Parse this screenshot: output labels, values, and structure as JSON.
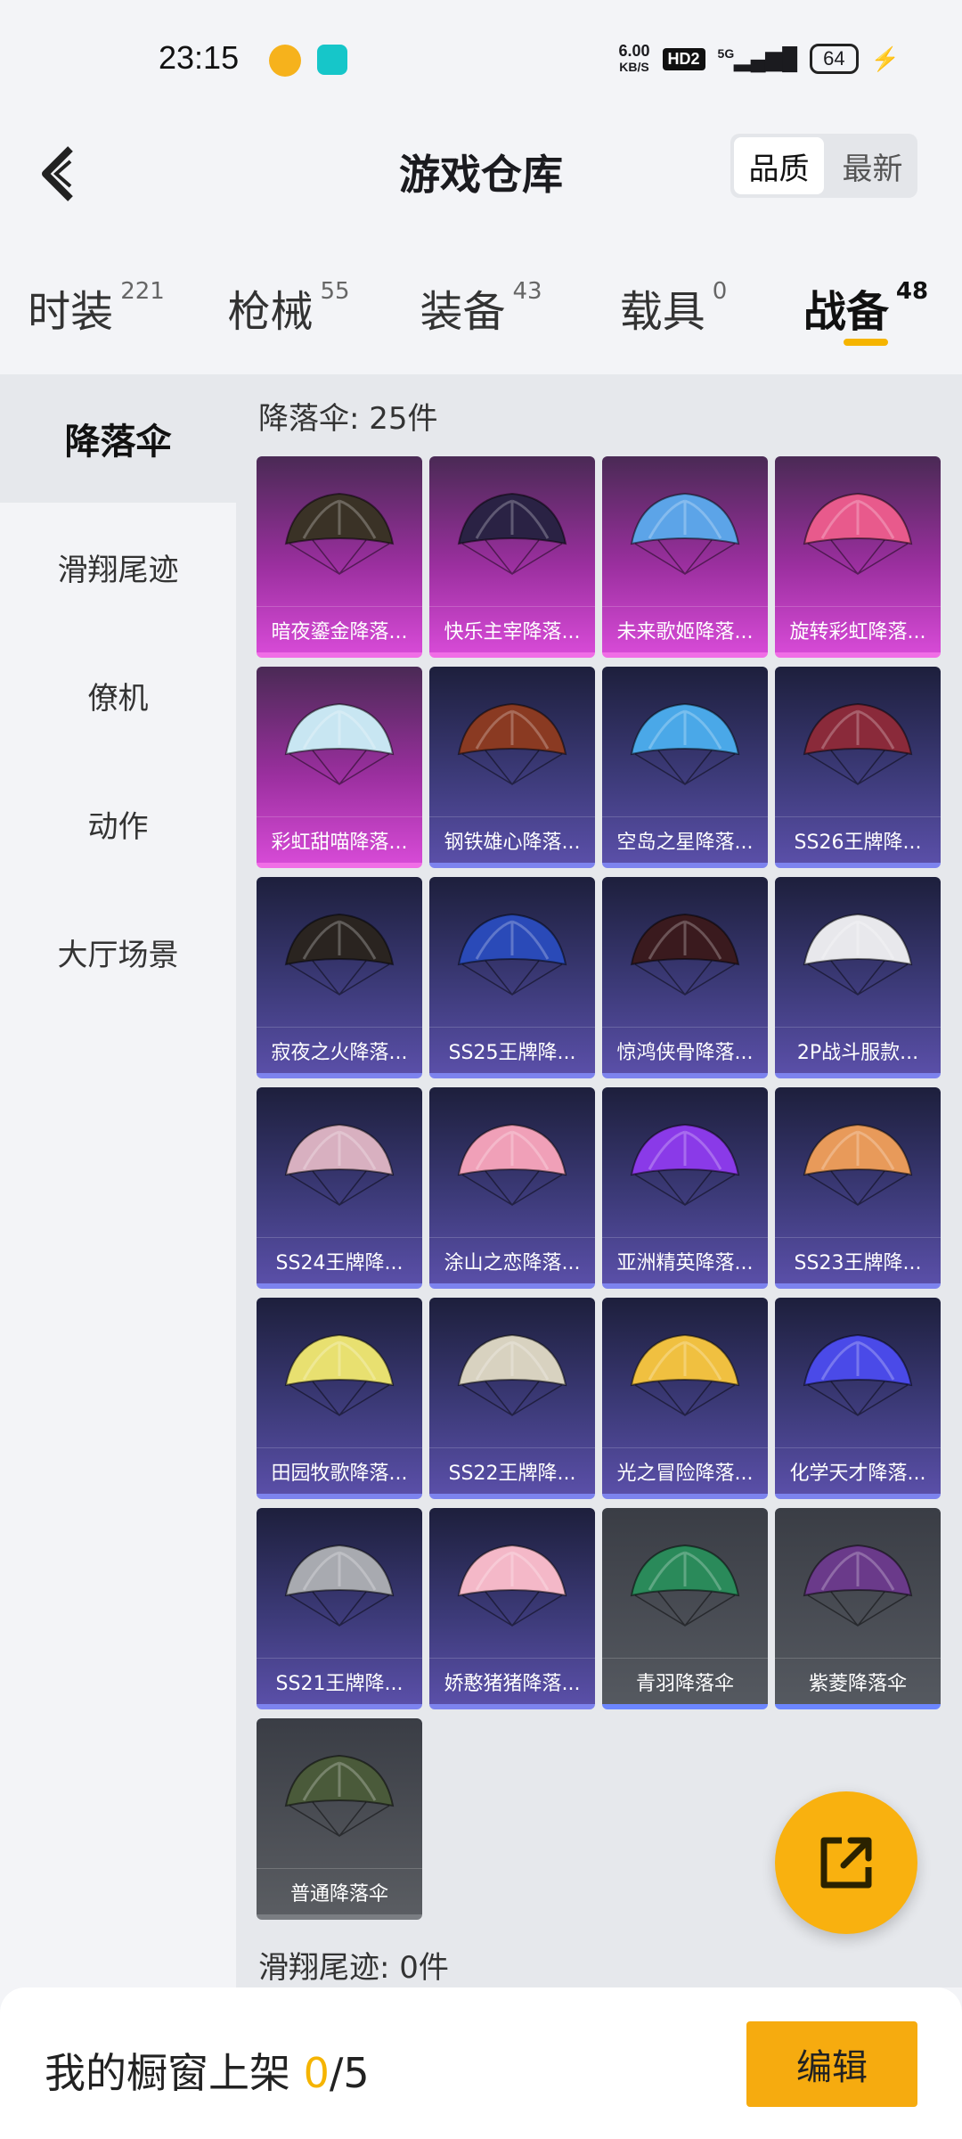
{
  "status_bar": {
    "time": "23:15",
    "net_speed": "6.00",
    "net_unit": "KB/S",
    "hd_badge": "HD2",
    "signal": "5G",
    "battery": "64"
  },
  "header": {
    "title": "游戏仓库",
    "sort_options": [
      "品质",
      "最新"
    ],
    "sort_active": "品质"
  },
  "tabs": [
    {
      "label": "时装",
      "count": "221"
    },
    {
      "label": "枪械",
      "count": "55"
    },
    {
      "label": "装备",
      "count": "43"
    },
    {
      "label": "载具",
      "count": "0"
    },
    {
      "label": "战备",
      "count": "48"
    }
  ],
  "active_tab": "战备",
  "sidebar": {
    "items": [
      {
        "label": "降落伞"
      },
      {
        "label": "滑翔尾迹"
      },
      {
        "label": "僚机"
      },
      {
        "label": "动作"
      },
      {
        "label": "大厅场景"
      }
    ],
    "active": "降落伞"
  },
  "sections": {
    "parachute_title": "降落伞: 25件",
    "trail_title": "滑翔尾迹: 0件"
  },
  "items": [
    {
      "name": "暗夜鎏金降落...",
      "tier": "pink",
      "color": "#3a3226"
    },
    {
      "name": "快乐主宰降落...",
      "tier": "pink",
      "color": "#2a2244"
    },
    {
      "name": "未来歌姬降落...",
      "tier": "pink",
      "color": "#5ca4e8"
    },
    {
      "name": "旋转彩虹降落...",
      "tier": "pink",
      "color": "#e85a8c"
    },
    {
      "name": "彩虹甜喵降落...",
      "tier": "pink",
      "color": "#c8e6f2"
    },
    {
      "name": "钢铁雄心降落...",
      "tier": "blue",
      "color": "#8a3a22"
    },
    {
      "name": "空岛之星降落...",
      "tier": "blue",
      "color": "#4aa8e8"
    },
    {
      "name": "SS26王牌降...",
      "tier": "blue",
      "color": "#8a2a3a"
    },
    {
      "name": "寂夜之火降落...",
      "tier": "blue",
      "color": "#2a2420"
    },
    {
      "name": "SS25王牌降...",
      "tier": "blue",
      "color": "#2a4ab8"
    },
    {
      "name": "惊鸿侠骨降落...",
      "tier": "blue",
      "color": "#3a1a1e"
    },
    {
      "name": "2P战斗服款...",
      "tier": "blue",
      "color": "#e8e8ec"
    },
    {
      "name": "SS24王牌降...",
      "tier": "blue",
      "color": "#d8b0c0"
    },
    {
      "name": "涂山之恋降落...",
      "tier": "blue",
      "color": "#f0a0b8"
    },
    {
      "name": "亚洲精英降落...",
      "tier": "blue",
      "color": "#8a3ae8"
    },
    {
      "name": "SS23王牌降...",
      "tier": "blue",
      "color": "#e89a5a"
    },
    {
      "name": "田园牧歌降落...",
      "tier": "blue",
      "color": "#e8e070"
    },
    {
      "name": "SS22王牌降...",
      "tier": "blue",
      "color": "#d8d2c0"
    },
    {
      "name": "光之冒险降落...",
      "tier": "blue",
      "color": "#f0c040"
    },
    {
      "name": "化学天才降落...",
      "tier": "blue",
      "color": "#4a4ae8"
    },
    {
      "name": "SS21王牌降...",
      "tier": "blue",
      "color": "#a8aab0"
    },
    {
      "name": "娇憨猪猪降落...",
      "tier": "blue",
      "color": "#f4b8c8"
    },
    {
      "name": "青羽降落伞",
      "tier": "gray",
      "color": "#2a8a5a"
    },
    {
      "name": "紫菱降落伞",
      "tier": "gray",
      "color": "#6a3a8a"
    },
    {
      "name": "普通降落伞",
      "tier": "gray2",
      "color": "#4a5a3a"
    }
  ],
  "bottom_bar": {
    "label": "我的橱窗上架 ",
    "current": "0",
    "total": "/5",
    "edit_label": "编辑"
  }
}
